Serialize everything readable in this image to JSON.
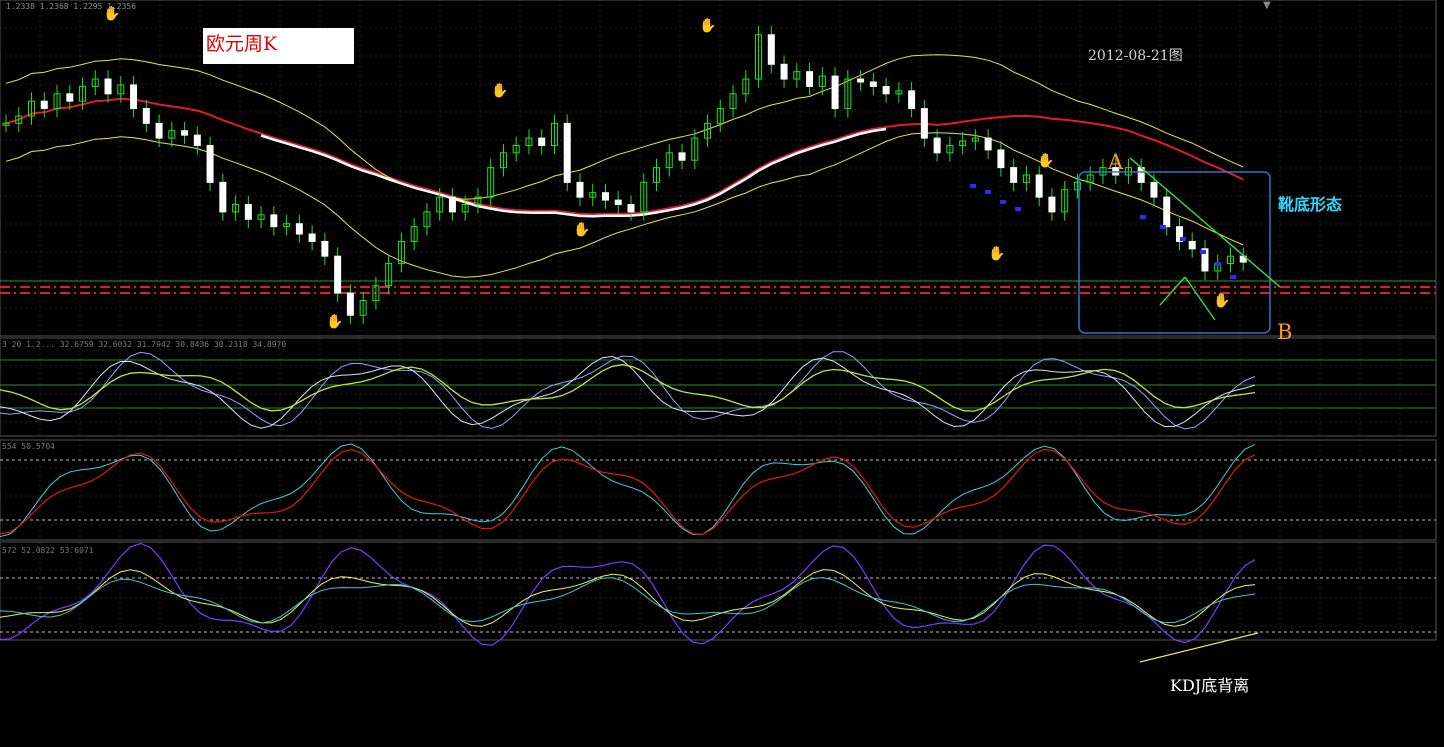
{
  "chart_data": {
    "type": "line",
    "title": "欧元周K",
    "date": "2012-08-21图",
    "ohlc_header": "1.2338 1.2368 1.2295 1.2356",
    "indicator_headers": [
      "3  20  1.2... 32.6759 32.6032 31.7942 30.8436 30.2318 34.8970",
      "554 50.5704",
      "572 52.0822 53.6071"
    ],
    "annotations": {
      "point_a": "A",
      "point_b": "B",
      "pattern": "靴底形态",
      "divergence": "KDJ底背离"
    },
    "price_series": [
      1.33,
      1.335,
      1.345,
      1.34,
      1.35,
      1.345,
      1.355,
      1.36,
      1.35,
      1.356,
      1.34,
      1.33,
      1.32,
      1.325,
      1.322,
      1.315,
      1.29,
      1.27,
      1.275,
      1.265,
      1.268,
      1.26,
      1.262,
      1.255,
      1.25,
      1.24,
      1.215,
      1.2,
      1.21,
      1.22,
      1.235,
      1.25,
      1.26,
      1.27,
      1.28,
      1.27,
      1.275,
      1.28,
      1.3,
      1.31,
      1.315,
      1.32,
      1.315,
      1.33,
      1.29,
      1.28,
      1.283,
      1.278,
      1.275,
      1.27,
      1.29,
      1.3,
      1.31,
      1.305,
      1.32,
      1.33,
      1.34,
      1.35,
      1.36,
      1.39,
      1.37,
      1.36,
      1.365,
      1.355,
      1.362,
      1.34,
      1.36,
      1.358,
      1.355,
      1.35,
      1.352,
      1.34,
      1.32,
      1.31,
      1.315,
      1.318,
      1.32,
      1.312,
      1.3,
      1.29,
      1.295,
      1.28,
      1.27,
      1.285,
      1.29,
      1.295,
      1.3,
      1.295,
      1.3,
      1.29,
      1.28,
      1.26,
      1.25,
      1.245,
      1.23,
      1.235,
      1.24,
      1.236
    ]
  },
  "colors": {
    "candle_up": "#1ee11e",
    "candle_down": "#ffffff",
    "ma_long": "#e01c2c",
    "ma_white": "#ffffff",
    "band": "#e8e83a",
    "grid": "#3a3a3a",
    "support": "#e02020",
    "box": "#2a78c8",
    "trend": "#39d439",
    "kdj_k": "#7a3cff",
    "kdj_d": "#f0f05a",
    "kdj_j": "#3ec6d8",
    "stoch_red": "#e01818",
    "stoch_cyan": "#3ed0d8"
  },
  "icons": [
    "arrow-down-icon",
    "fractal-up-icon",
    "fractal-down-icon"
  ]
}
